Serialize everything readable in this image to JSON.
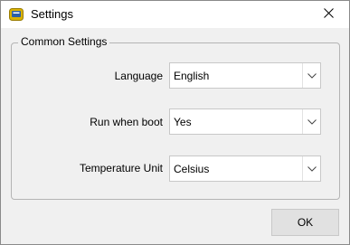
{
  "window": {
    "title": "Settings"
  },
  "group": {
    "label": "Common Settings"
  },
  "settings": [
    {
      "label": "Language",
      "value": "English"
    },
    {
      "label": "Run when boot",
      "value": "Yes"
    },
    {
      "label": "Temperature Unit",
      "value": "Celsius"
    }
  ],
  "buttons": {
    "ok_label": "OK"
  },
  "colors": {
    "app_icon_frame": "#c8a000",
    "app_icon_screen": "#2b5fa8"
  },
  "icons": {
    "app": "app-icon",
    "close": "close-icon",
    "dropdown": "chevron-down-icon"
  }
}
